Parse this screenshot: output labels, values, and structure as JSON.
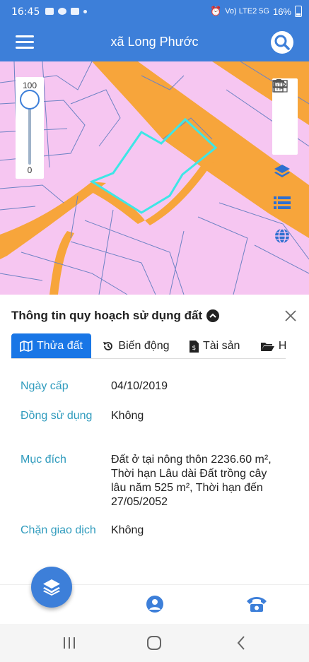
{
  "status_bar": {
    "time": "16:45",
    "network": "Vo) LTE2 5G",
    "battery": "16%"
  },
  "app_bar": {
    "title": "xã Long Phước",
    "menu_icon": "hamburger-menu-icon",
    "search_icon": "search-icon"
  },
  "map": {
    "zoom_slider": {
      "max_label": "100",
      "min_label": "0",
      "value": 100
    },
    "tools": [
      "ruler-icon",
      "area-measure-icon",
      "trash-icon"
    ],
    "controls": [
      "layers-icon",
      "list-icon",
      "globe-icon"
    ],
    "colors": {
      "land": "#f6c6f1",
      "road": "#f7a53b",
      "parcel_line": "#6d83c4",
      "selected": "#3ee6e6"
    }
  },
  "panel": {
    "title": "Thông tin quy hoạch sử dụng đất",
    "tabs": [
      {
        "label": "Thửa đất",
        "icon": "map-icon",
        "active": true
      },
      {
        "label": "Biến động",
        "icon": "history-icon",
        "active": false
      },
      {
        "label": "Tài sản",
        "icon": "document-dollar-icon",
        "active": false
      },
      {
        "label": "Hồ sơ",
        "icon": "folder-icon",
        "active": false
      }
    ],
    "fields": [
      {
        "key": "Ngày cấp",
        "value": "04/10/2019"
      },
      {
        "key": "Đồng sử dụng",
        "value": "Không"
      },
      {
        "key": "Mục đích",
        "value": "Đất ở tại nông thôn 2236.60 m², Thời hạn Lâu dài Đất trồng cây lâu năm 525 m², Thời hạn đến 27/05/2052"
      },
      {
        "key": "Chặn giao dịch",
        "value": "Không"
      }
    ]
  },
  "bottom_bar": {
    "fab_icon": "layers-icon",
    "icons": [
      "user-icon",
      "phone-icon"
    ]
  },
  "colors": {
    "primary": "#3d7fd9",
    "tab_active": "#1976e6",
    "field_key": "#2f9bbd"
  }
}
